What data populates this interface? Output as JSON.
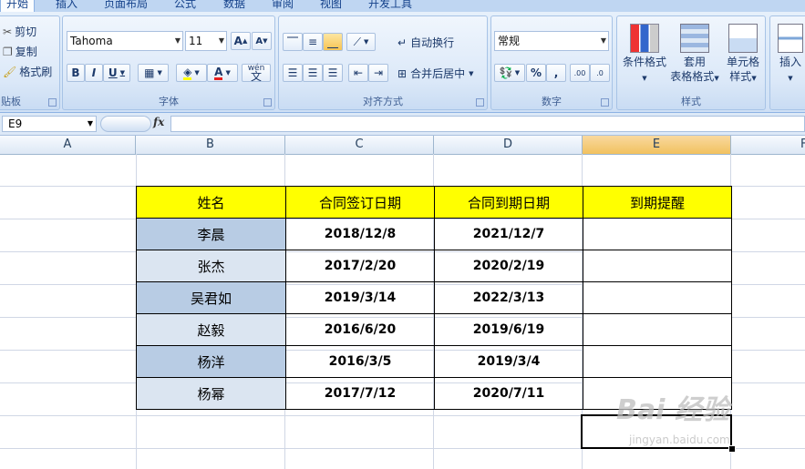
{
  "ribbon": {
    "tabs": [
      "开始",
      "插入",
      "页面布局",
      "公式",
      "数据",
      "审阅",
      "视图",
      "开发工具"
    ],
    "clipboard": {
      "cut": "剪切",
      "copy": "复制",
      "format_painter": "格式刷",
      "label": "贴板"
    },
    "font": {
      "name": "Tahoma",
      "size": "11",
      "bold": "B",
      "italic": "I",
      "underline": "U",
      "font_color_glyph": "A",
      "phonetic": "wén",
      "label": "字体"
    },
    "alignment": {
      "wrap_text": "自动换行",
      "merge_center": "合并后居中",
      "label": "对齐方式"
    },
    "number": {
      "format": "常规",
      "percent": "%",
      "comma": ",",
      "inc_decimal": ".00",
      "dec_decimal": ".0",
      "label": "数字"
    },
    "styles": {
      "conditional": "条件格式",
      "table_format_1": "套用",
      "table_format_2": "表格格式",
      "cell_styles_1": "单元格",
      "cell_styles_2": "样式",
      "label": "样式"
    },
    "cells": {
      "insert": "插入"
    }
  },
  "formula_bar": {
    "name_box": "E9",
    "fx": "fx",
    "value": ""
  },
  "sheet": {
    "columns": [
      "A",
      "B",
      "C",
      "D",
      "E",
      "F"
    ],
    "selected_column": "E",
    "headers": [
      "姓名",
      "合同签订日期",
      "合同到期日期",
      "到期提醒"
    ],
    "rows": [
      {
        "name": "李晨",
        "signed": "2018/12/8",
        "expires": "2021/12/7",
        "reminder": ""
      },
      {
        "name": "张杰",
        "signed": "2017/2/20",
        "expires": "2020/2/19",
        "reminder": ""
      },
      {
        "name": "吴君如",
        "signed": "2019/3/14",
        "expires": "2022/3/13",
        "reminder": ""
      },
      {
        "name": "赵毅",
        "signed": "2016/6/20",
        "expires": "2019/6/19",
        "reminder": ""
      },
      {
        "name": "杨洋",
        "signed": "2016/3/5",
        "expires": "2019/3/4",
        "reminder": ""
      },
      {
        "name": "杨幂",
        "signed": "2017/7/12",
        "expires": "2020/7/11",
        "reminder": ""
      }
    ]
  },
  "watermark": {
    "brand": "Bai 经验",
    "url": "jingyan.baidu.com"
  },
  "colors": {
    "header_fill": "#ffff00",
    "name_fill_dark": "#b8cce4",
    "name_fill_light": "#dbe5f1",
    "selected_col": "#f6c768"
  }
}
